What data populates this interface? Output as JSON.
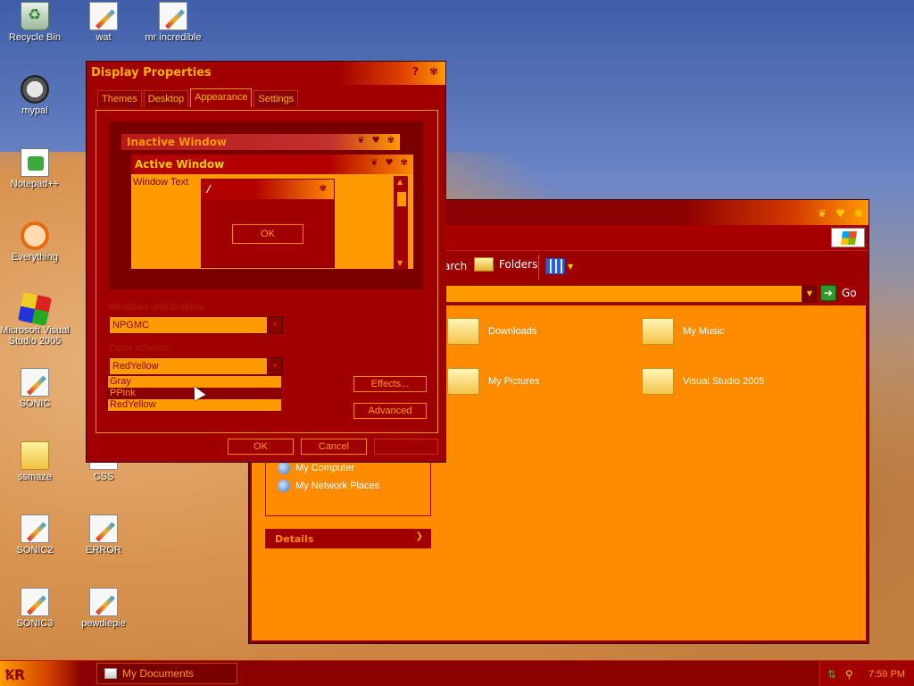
{
  "desktop": {
    "icons": [
      {
        "label": "Recycle Bin",
        "icon": "recycle-bin-icon"
      },
      {
        "label": "wat",
        "icon": "document-icon"
      },
      {
        "label": "mr incredible",
        "icon": "document-icon"
      },
      {
        "label": "mypal",
        "icon": "raccoon-icon"
      },
      {
        "label": "Notepad++",
        "icon": "notepad-plus-icon"
      },
      {
        "label": "Everything",
        "icon": "everything-search-icon"
      },
      {
        "label": "Microsoft Visual Studio 2005",
        "icon": "visual-studio-icon"
      },
      {
        "label": "SONIC",
        "icon": "document-icon"
      },
      {
        "label": "ssmaze",
        "icon": "folder-icon"
      },
      {
        "label": "CSS",
        "icon": "document-icon"
      },
      {
        "label": "SONIC2",
        "icon": "document-icon"
      },
      {
        "label": "ERROR",
        "icon": "document-icon"
      },
      {
        "label": "SONIC3",
        "icon": "document-icon"
      },
      {
        "label": "pewdiepie",
        "icon": "document-icon"
      }
    ]
  },
  "explorer": {
    "toolbar": {
      "search_label": "arch",
      "folders_label": "Folders"
    },
    "address": {
      "go_label": "Go"
    },
    "items": [
      {
        "label": "Downloads",
        "icon": "folder-icon"
      },
      {
        "label": "My Music",
        "icon": "music-folder-icon"
      },
      {
        "label": "My Pictures",
        "icon": "pictures-folder-icon"
      },
      {
        "label": "Visual Studio 2005",
        "icon": "folder-icon"
      }
    ],
    "other_places": [
      {
        "label": "My Computer",
        "icon": "computer-icon"
      },
      {
        "label": "My Network Places",
        "icon": "network-icon"
      }
    ],
    "details_label": "Details"
  },
  "dialog": {
    "title": "Display Properties",
    "help": "?",
    "tabs": [
      "Themes",
      "Desktop",
      "Appearance",
      "Settings"
    ],
    "active_tab": "Appearance",
    "preview": {
      "inactive_title": "Inactive Window",
      "active_title": "Active Window",
      "window_text": "Window Text",
      "message_title": "/",
      "ok_label": "OK"
    },
    "windows_buttons_label": "Windows and buttons:",
    "windows_buttons_value": "NPGMC",
    "color_scheme_label": "Color scheme:",
    "color_scheme_value": "RedYellow",
    "color_scheme_options": [
      "Gray",
      "PPink",
      "RedYellow"
    ],
    "highlighted_option": "PPink",
    "effects_label": "Effects...",
    "advanced_label": "Advanced",
    "ok_label": "OK",
    "cancel_label": "Cancel"
  },
  "taskbar": {
    "task_label": "My Documents",
    "clock": "7:59 PM"
  },
  "colors": {
    "frame": "#a00000",
    "accent": "#ff9a00",
    "text_on_dark": "#ffb000"
  }
}
